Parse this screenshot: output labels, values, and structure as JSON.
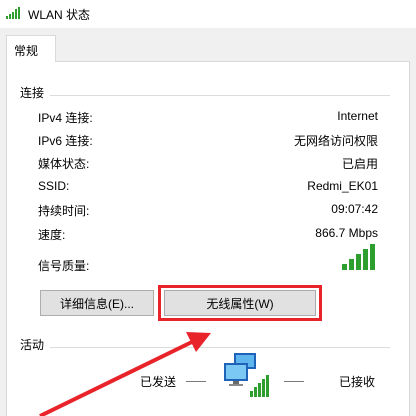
{
  "window": {
    "title": "WLAN 状态",
    "icon": "wifi-signal-icon"
  },
  "tabs": [
    {
      "label": "常规",
      "selected": true
    }
  ],
  "connection": {
    "section_title": "连接",
    "rows": [
      {
        "label": "IPv4 连接:",
        "value": "Internet"
      },
      {
        "label": "IPv6 连接:",
        "value": "无网络访问权限"
      },
      {
        "label": "媒体状态:",
        "value": "已启用"
      },
      {
        "label": "SSID:",
        "value": "Redmi_EK01"
      },
      {
        "label": "持续时间:",
        "value": "09:07:42"
      },
      {
        "label": "速度:",
        "value": "866.7 Mbps"
      }
    ],
    "signal_label": "信号质量:",
    "signal_bars_lit": 5,
    "signal_bars_total": 5,
    "signal_color": "#2e9e2e"
  },
  "buttons": {
    "details": "详细信息(E)...",
    "wireless_properties": "无线属性(W)"
  },
  "activity": {
    "section_title": "活动",
    "sent_label": "已发送",
    "received_label": "已接收"
  },
  "annotation": {
    "highlight_color": "#e8232a"
  }
}
